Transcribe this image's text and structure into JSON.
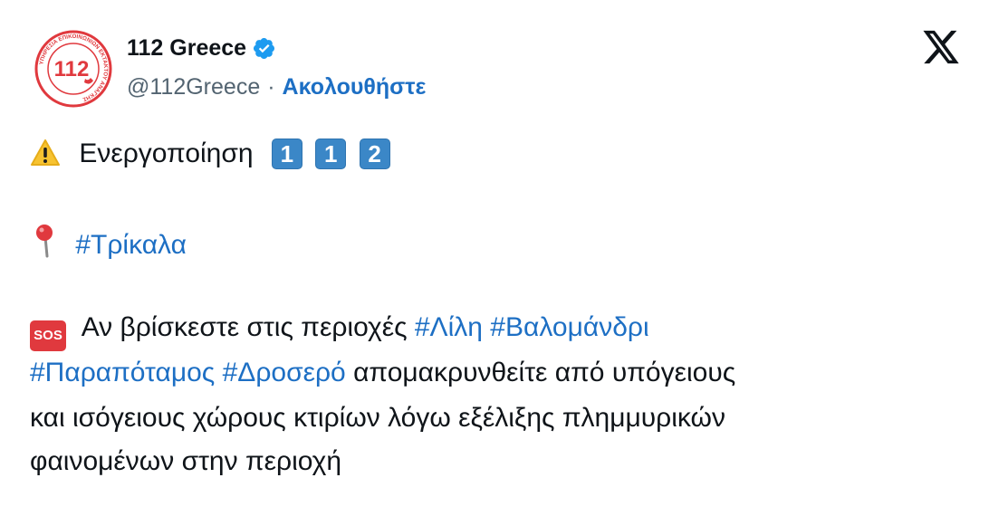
{
  "account": {
    "name": "112 Greece",
    "handle": "@112Greece",
    "separator": "·",
    "follow_label": "Ακολουθήστε",
    "avatar": {
      "number": "112",
      "ring_text": "ΥΠΗΡΕΣΙΑ ΕΠΙΚΟΙΝΩΝΙΩΝ ΕΚΤΑΚΤΟΥ ΑΝΑΓΚΗΣ",
      "color": "#e0393e"
    },
    "verified_icon": "verified-badge-icon",
    "verified_color": "#1d9bf0"
  },
  "platform_icon": "x-logo-icon",
  "tweet": {
    "line1": {
      "emoji": "warning-icon",
      "text": "Ενεργοποίηση",
      "keycaps": [
        "1",
        "1",
        "2"
      ]
    },
    "line2": {
      "emoji": "pin-icon",
      "hashtag": "#Τρίκαλα"
    },
    "line3": {
      "sos_label": "SOS",
      "text": "Αν βρίσκεστε στις περιοχές",
      "hashtags": [
        "#Λίλη",
        "#Βαλομάνδρι"
      ]
    },
    "line4": {
      "hashtags": [
        "#Παραπόταμος",
        "#Δροσερό"
      ],
      "text": "απομακρυνθείτε από υπόγειους"
    },
    "line5": "και ισόγειους χώρους κτιρίων λόγω εξέλιξης πλημμυρικών",
    "line6": "φαινομένων στην περιοχή"
  },
  "colors": {
    "link": "#1d6fc4",
    "secondary_text": "#536471",
    "primary_text": "#0f1419"
  }
}
